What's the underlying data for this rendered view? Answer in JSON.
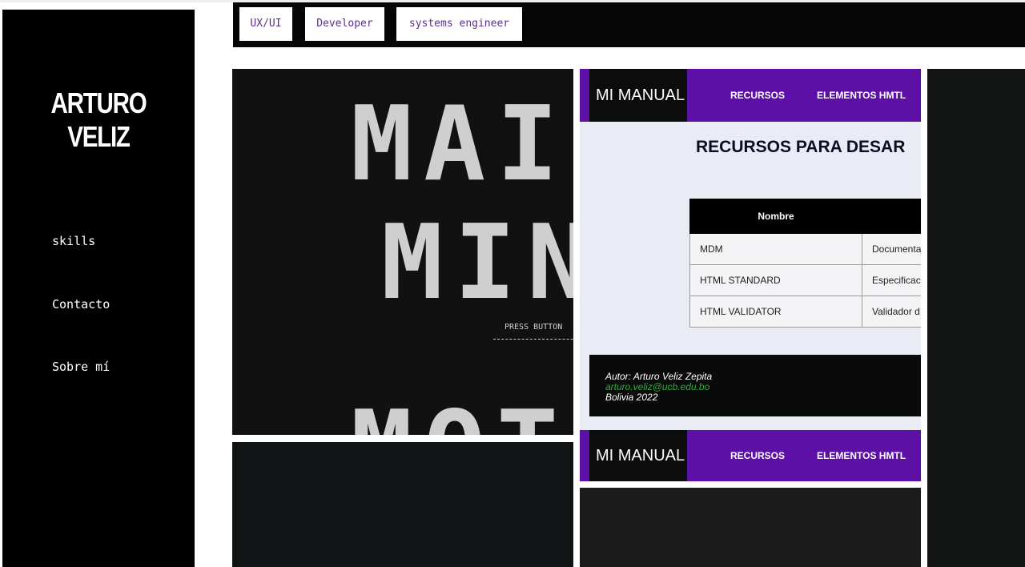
{
  "sidebar": {
    "brand": "ARTURO VELIZ",
    "nav": [
      {
        "label": "skills"
      },
      {
        "label": "Contacto"
      },
      {
        "label": "Sobre mí"
      }
    ]
  },
  "tags": [
    "UX/UI",
    "Developer",
    "systems engineer"
  ],
  "projects": {
    "arcade": {
      "line1": "MAI",
      "line2": "MIN",
      "line3": "MOT",
      "press": "PRESS BUTTON"
    },
    "manual": {
      "logo": "MI MANUAL",
      "nav_links": [
        "RECURSOS",
        "ELEMENTOS HMTL"
      ],
      "title": "RECURSOS PARA DESAR",
      "table": {
        "headers": [
          "Nombre",
          ""
        ],
        "rows": [
          [
            "MDM",
            "Documenta"
          ],
          [
            "HTML STANDARD",
            "Especificaci"
          ],
          [
            "HTML VALIDATOR",
            "Validador d"
          ]
        ]
      },
      "footer": {
        "author": "Autor: Arturo Veliz Zepita",
        "email": "arturo.veliz@ucb.edu.bo",
        "place": "Bolivia 2022"
      }
    }
  },
  "colors": {
    "manual_nav": "#5c10a6",
    "tag_text": "#5a2e8c",
    "footer_email": "#2fae3a"
  }
}
